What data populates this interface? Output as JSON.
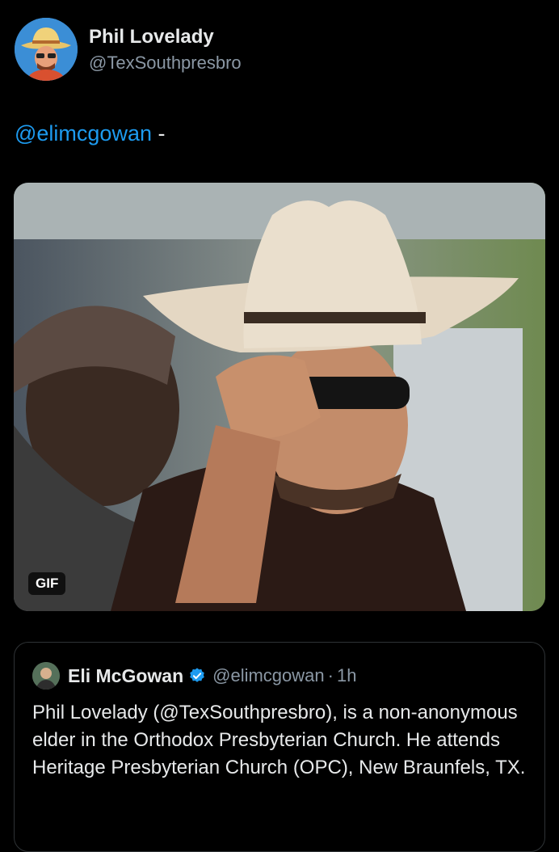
{
  "tweet": {
    "author": {
      "display_name": "Phil Lovelady",
      "handle": "@TexSouthpresbro",
      "avatar_icon": "cowboy-cartoon-avatar"
    },
    "text_mention": "@elimcgowan",
    "text_suffix": " -",
    "media": {
      "type": "GIF",
      "badge": "GIF",
      "description": "man in a cowboy hat and sunglasses tipping his hat"
    }
  },
  "quoted_tweet": {
    "author": {
      "display_name": "Eli McGowan",
      "verified": true,
      "handle": "@elimcgowan",
      "separator": "·",
      "time": "1h"
    },
    "text": "Phil Lovelady (@TexSouthpresbro), is a non-anonymous elder in the Orthodox Presbyterian Church. He attends Heritage Presbyterian Church (OPC), New Braunfels, TX."
  },
  "colors": {
    "background": "#000000",
    "link": "#1d9bf0",
    "secondary_text": "#8b98a5",
    "verified_badge": "#1d9bf0"
  }
}
